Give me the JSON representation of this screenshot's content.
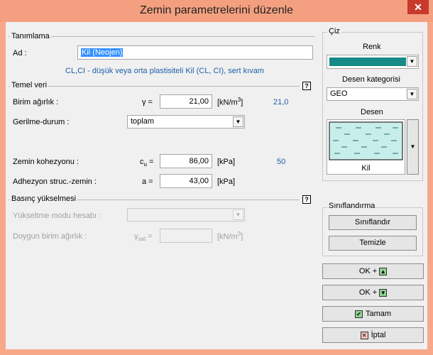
{
  "window": {
    "title": "Zemin parametrelerini düzenle",
    "close_glyph": "✕"
  },
  "tanimlama": {
    "section_label": "Tanımlama",
    "name_label": "Ad :",
    "name_value": "Kil (Neojen)",
    "description": "CL,CI - düşük veya orta plastisiteli Kil (CL, CI), sert kıvam"
  },
  "temel_veri": {
    "section_label": "Temel veri",
    "help": "?",
    "unit_weight": {
      "label": "Birim ağırlık :",
      "symbol": "γ =",
      "value": "21,00",
      "unit_main": "[kN/m",
      "unit_sup": "3",
      "unit_end": "]",
      "hint": "21,0"
    },
    "stress_state": {
      "label": "Gerilme-durum :",
      "value": "toplam"
    },
    "cohesion": {
      "label": "Zemin kohezyonu :",
      "symbol_main": "c",
      "symbol_sub": "u",
      "symbol_end": " =",
      "value": "86,00",
      "unit": "[kPa]",
      "hint": "50"
    },
    "adhesion": {
      "label": "Adhezyon struc.-zemin :",
      "symbol": "a =",
      "value": "43,00",
      "unit": "[kPa]"
    }
  },
  "basinc": {
    "section_label": "Basınç yükselmesi",
    "help": "?",
    "mode_label": "Yükseltme modu hesabı :",
    "sat_label": "Doygun birim ağırlık :",
    "sat_symbol_main": "γ",
    "sat_symbol_sub": "sat",
    "sat_symbol_end": " =",
    "sat_unit_main": "[kN/m",
    "sat_unit_sup": "3",
    "sat_unit_end": "]"
  },
  "ciz": {
    "section_label": "Çiz",
    "color_label": "Renk",
    "color_value": "#168a86",
    "pattern_category_label": "Desen kategorisi",
    "pattern_category_value": "GEO",
    "pattern_label": "Desen",
    "pattern_name": "Kil"
  },
  "siniflandirma": {
    "section_label": "Sınıflandırma",
    "classify_button": "Sınıflandır",
    "clear_button": "Temizle"
  },
  "buttons": {
    "ok_up": "OK +",
    "ok_down": "OK +",
    "tamam": "Tamam",
    "iptal": "İptal",
    "ok_up_glyph": "▲",
    "ok_down_glyph": "▼",
    "tamam_glyph": "✔",
    "iptal_glyph": "✕"
  },
  "colors": {
    "accent_info": "#1c5fa8",
    "titlebar": "#f4a080",
    "swatch": "#168a86",
    "pattern_bg": "#c8eeec"
  }
}
